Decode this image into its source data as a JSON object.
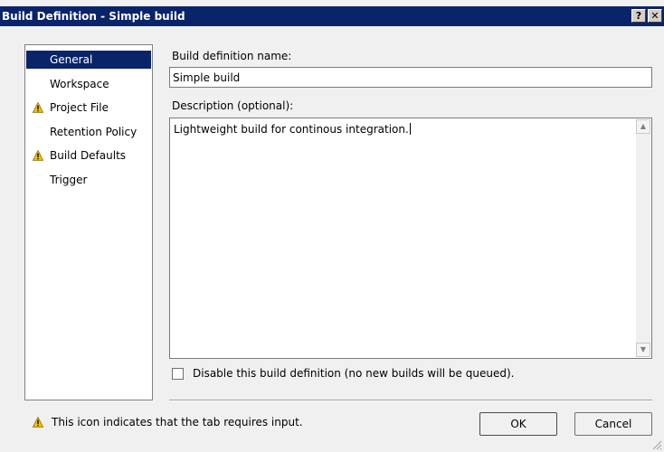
{
  "window": {
    "title": "Build Definition - Simple build",
    "help_label": "?",
    "close_label": "✕"
  },
  "nav": {
    "items": [
      {
        "label": "General",
        "warning": false,
        "selected": true
      },
      {
        "label": "Workspace",
        "warning": false,
        "selected": false
      },
      {
        "label": "Project File",
        "warning": true,
        "selected": false
      },
      {
        "label": "Retention Policy",
        "warning": false,
        "selected": false
      },
      {
        "label": "Build Defaults",
        "warning": true,
        "selected": false
      },
      {
        "label": "Trigger",
        "warning": false,
        "selected": false
      }
    ]
  },
  "form": {
    "name_label": "Build definition name:",
    "name_value": "Simple build",
    "description_label": "Description (optional):",
    "description_value": "Lightweight build for continous integration.",
    "disable_label": "Disable this build definition (no new builds will be queued).",
    "disable_checked": false
  },
  "footer": {
    "note": "This icon indicates that the tab requires input.",
    "ok_label": "OK",
    "cancel_label": "Cancel"
  },
  "icons": {
    "warning": "warning-icon",
    "grip": "resize-grip-icon"
  },
  "colors": {
    "titlebar": "#0a246a",
    "selected": "#0a246a",
    "warning_fill": "#f5c400"
  }
}
